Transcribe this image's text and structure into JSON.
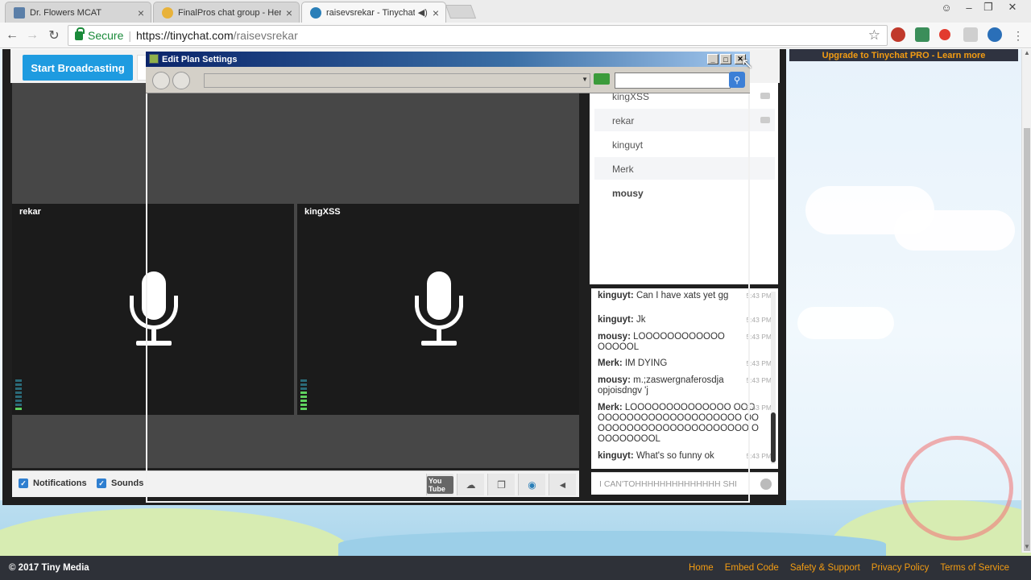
{
  "browser": {
    "tabs": [
      {
        "title": "Dr. Flowers MCAT",
        "favicon_color": "#5b7fa8",
        "active": false
      },
      {
        "title": "FinalPros chat group - Here",
        "favicon_color": "#e8b23a",
        "active": false
      },
      {
        "title": "raisevsrekar - Tinychat",
        "favicon_color": "#2a7fb8",
        "active": true,
        "audio": true
      }
    ],
    "secure_label": "Secure",
    "url_host": "https://tinychat.com",
    "url_path": "/raisevsrekar"
  },
  "header": {
    "start_broadcasting": "Start Broadcasting",
    "tab_partial": "h"
  },
  "banner": {
    "upgrade": "Upgrade to Tinychat PRO - Learn more"
  },
  "dialog": {
    "title": "Edit Plan Settings"
  },
  "videos": [
    {
      "name": "rekar",
      "level_on": 1
    },
    {
      "name": "kingXSS",
      "level_on": 5
    }
  ],
  "users": [
    {
      "name": "kingXSS",
      "alt": false,
      "bold": false,
      "camera": true
    },
    {
      "name": "rekar",
      "alt": true,
      "bold": false,
      "camera": true
    },
    {
      "name": "kinguyt",
      "alt": false,
      "bold": false,
      "camera": false
    },
    {
      "name": "Merk",
      "alt": true,
      "bold": false,
      "camera": false
    },
    {
      "name": "mousy",
      "alt": false,
      "bold": true,
      "camera": false
    }
  ],
  "messages": [
    {
      "who": "kinguyt:",
      "text": "Can I have xats yet gg",
      "time": "5:43 PM"
    },
    {
      "who": "kinguyt:",
      "text": "Jk",
      "time": "5:43 PM"
    },
    {
      "who": "mousy:",
      "text": "LOOOOOOOOOOOO OOOOOL",
      "time": "5:43 PM"
    },
    {
      "who": "Merk:",
      "text": "IM DYING",
      "time": "5:43 PM"
    },
    {
      "who": "mousy:",
      "text": "m.;zaswergnaferosdja opjoisdngv 'j",
      "time": "5:43 PM"
    },
    {
      "who": "Merk:",
      "text": "LOOOOOOOOOOOOOO OOOOOOOOOOOOOOOOOOOOOOO OOOOOOOOOOOOOOOOOOOOOOO OOOOOOOOOL",
      "time": "5:43 PM"
    },
    {
      "who": "kinguyt:",
      "text": "What's so funny ok",
      "time": "5:43 PM"
    }
  ],
  "chat_input": "I CAN'TOHHHHHHHHHHHHHH SHI",
  "bottom": {
    "notifications": "Notifications",
    "sounds": "Sounds",
    "youtube": "You Tube"
  },
  "footer": {
    "copyright": "© 2017 Tiny Media",
    "links": [
      "Home",
      "Embed Code",
      "Safety & Support",
      "Privacy Policy",
      "Terms of Service"
    ]
  }
}
